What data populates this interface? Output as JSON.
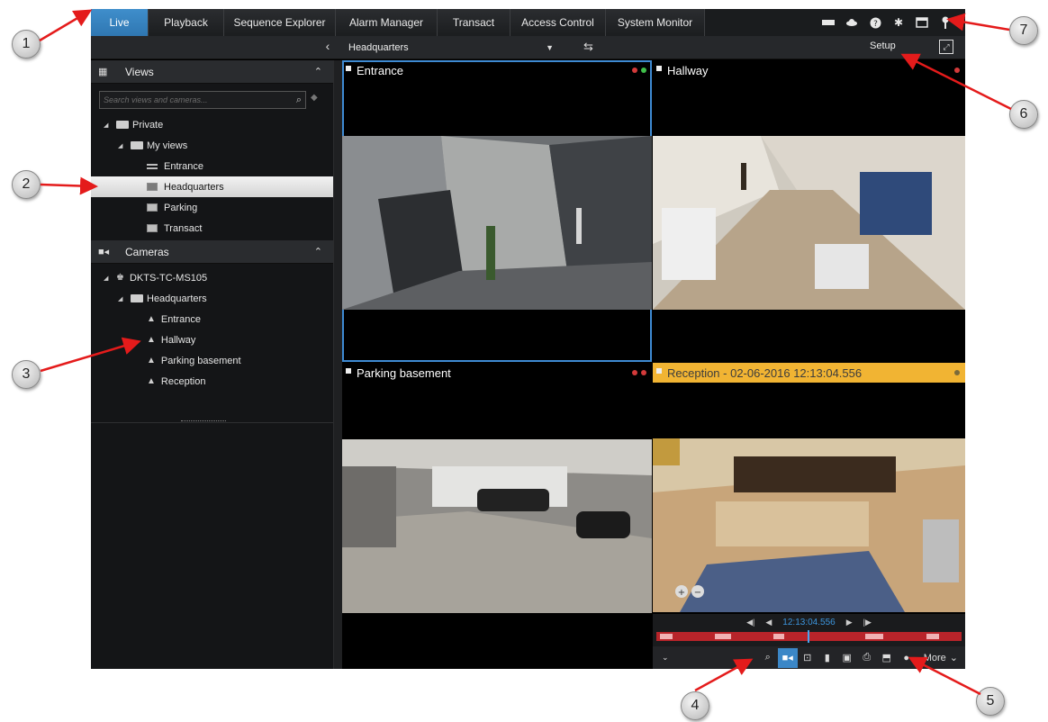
{
  "nav": {
    "tabs": [
      {
        "label": "Live",
        "active": true
      },
      {
        "label": "Playback"
      },
      {
        "label": "Sequence Explorer"
      },
      {
        "label": "Alarm Manager"
      },
      {
        "label": "Transact"
      },
      {
        "label": "Access Control"
      },
      {
        "label": "System Monitor"
      }
    ],
    "right_icons": [
      "monitor-icon",
      "cloud-icon",
      "help-icon",
      "settings-icon",
      "window-icon",
      "key-icon"
    ]
  },
  "toolbar": {
    "collapse_icon": "chevron-left-icon",
    "view_selected": "Headquarters",
    "swap_icon": "swap-icon",
    "setup_label": "Setup",
    "fullscreen_icon": "fullscreen-icon"
  },
  "sidebar": {
    "views": {
      "title": "Views",
      "search_placeholder": "Search views and cameras...",
      "tree": [
        {
          "label": "Private",
          "level": 0,
          "kind": "folder",
          "expanded": true
        },
        {
          "label": "My views",
          "level": 1,
          "kind": "folder",
          "expanded": true
        },
        {
          "label": "Entrance",
          "level": 2,
          "kind": "view"
        },
        {
          "label": "Headquarters",
          "level": 2,
          "kind": "view",
          "selected": true
        },
        {
          "label": "Parking",
          "level": 2,
          "kind": "view"
        },
        {
          "label": "Transact",
          "level": 2,
          "kind": "view"
        }
      ]
    },
    "cameras": {
      "title": "Cameras",
      "tree": [
        {
          "label": "DKTS-TC-MS105",
          "level": 0,
          "kind": "server"
        },
        {
          "label": "Headquarters",
          "level": 1,
          "kind": "folder"
        },
        {
          "label": "Entrance",
          "level": 2,
          "kind": "camera"
        },
        {
          "label": "Hallway",
          "level": 2,
          "kind": "camera"
        },
        {
          "label": "Parking basement",
          "level": 2,
          "kind": "camera"
        },
        {
          "label": "Reception",
          "level": 2,
          "kind": "camera"
        }
      ]
    }
  },
  "tiles": [
    {
      "title": "Entrance",
      "active": true,
      "indicators": [
        "#d33a3a",
        "#3fbf4a"
      ]
    },
    {
      "title": "Hallway",
      "indicators": [
        "#d33a3a"
      ]
    },
    {
      "title": "Parking basement",
      "indicators": [
        "#d33a3a",
        "#d33a3a"
      ]
    },
    {
      "title": "Reception - 02-06-2016 12:13:04.556",
      "highlight": "#f1b433",
      "indicators": [
        "#7a6a3a"
      ]
    }
  ],
  "playback": {
    "time": "12:13:04.556"
  },
  "camera_toolbar": {
    "more_label": "More",
    "icons": [
      "search-recording-icon",
      "live-camera-icon",
      "zoom-icon",
      "bookmark-icon",
      "save-icon",
      "print-icon",
      "export-icon",
      "record-icon"
    ]
  },
  "callouts": [
    "1",
    "2",
    "3",
    "4",
    "5",
    "6",
    "7"
  ],
  "colors": {
    "accent": "#3e8ad2",
    "highlight": "#f1b433",
    "timeline_red": "#b8242a",
    "arrow": "#e41b1b"
  }
}
